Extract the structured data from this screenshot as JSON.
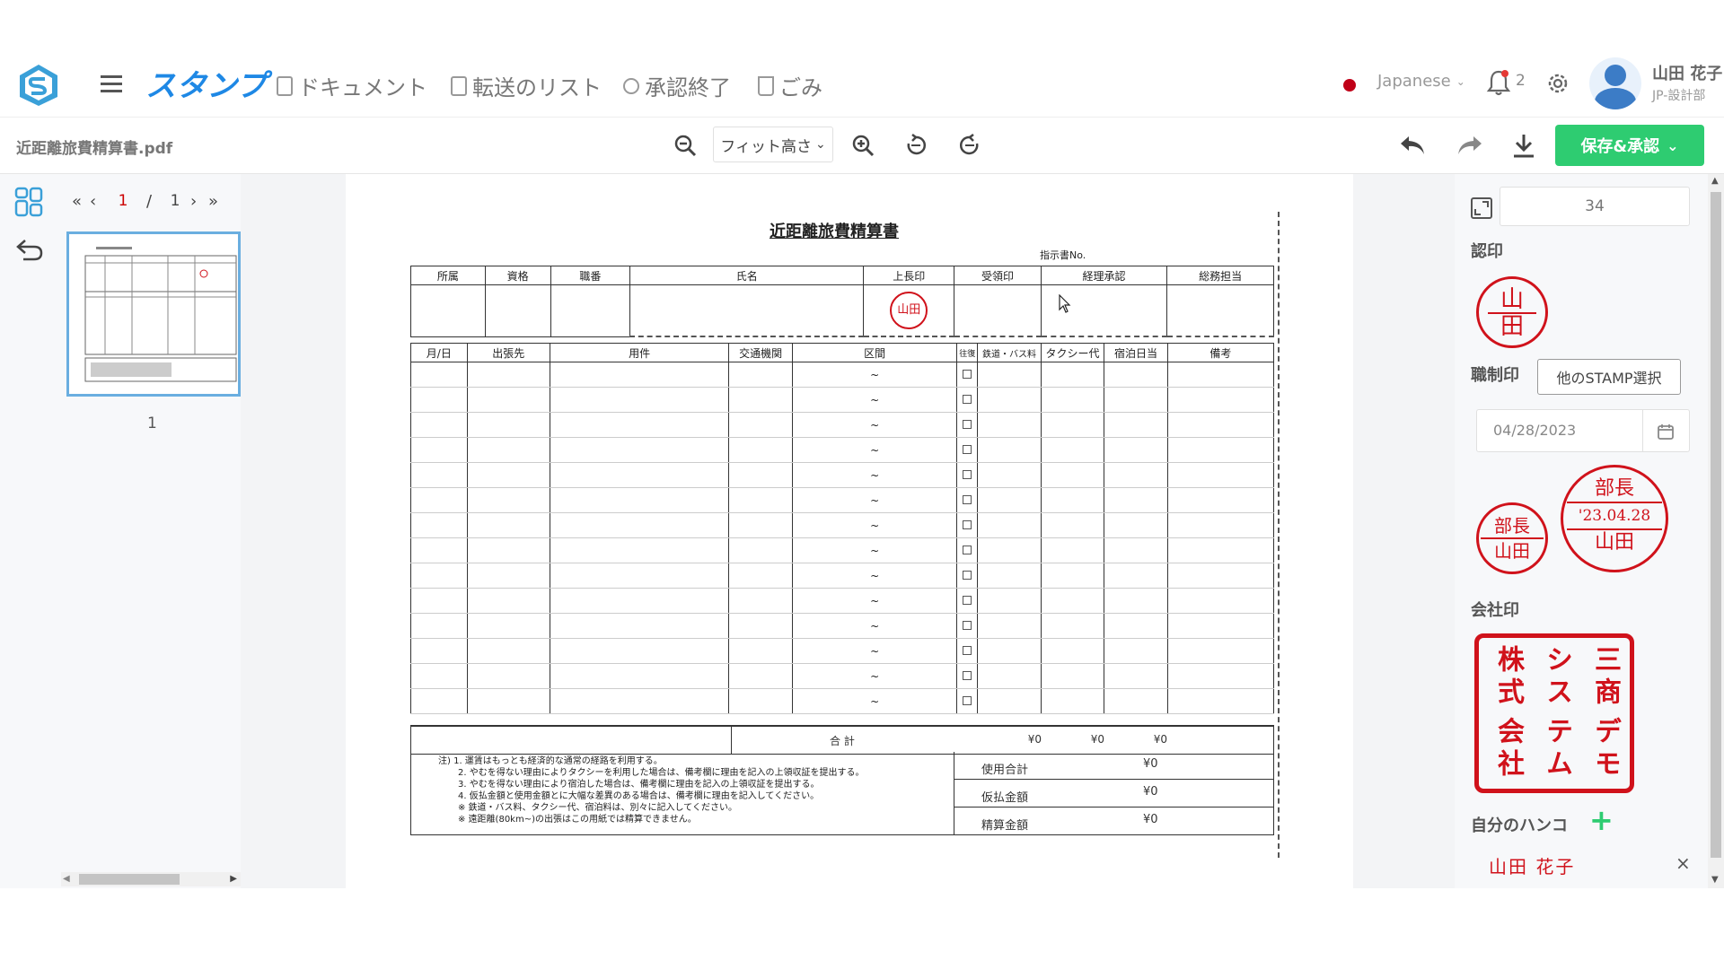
{
  "app": {
    "name": "スタンプ",
    "nav": [
      "ドキュメント",
      "転送のリスト",
      "承認終了",
      "ごみ"
    ],
    "language": "Japanese",
    "notification_count": "2",
    "user": {
      "name": "山田 花子",
      "dept": "JP-設計部"
    }
  },
  "toolbar": {
    "file_name": "近距離旅費精算書.pdf",
    "zoom_mode": "フィット高さ",
    "save_label": "保存&承認"
  },
  "pager": {
    "current": "1",
    "separator": "/",
    "total": "1"
  },
  "thumbnail": {
    "page_label": "1"
  },
  "right": {
    "size_value": "34",
    "ninin_label": "認印",
    "ninin_stamp": [
      "山",
      "田"
    ],
    "shokusei_label": "職制印",
    "other_stamp_button": "他のSTAMP選択",
    "date_value": "04/28/2023",
    "small_stamp": {
      "top": "部長",
      "bottom": "山田"
    },
    "date_stamp": {
      "top": "部長",
      "middle": "'23.04.28",
      "bottom": "山田"
    },
    "company_label": "会社印",
    "company_stamp_cols": [
      "三商",
      "デモ",
      "シス",
      "テム",
      "株式",
      "会社"
    ],
    "my_hanko_label": "自分のハンコ",
    "my_hanko_value": "山田 花子"
  },
  "document": {
    "title": "近距離旅費精算書",
    "memo_no": "指示書No.",
    "header_cols": [
      "所属",
      "資格",
      "職番",
      "氏名",
      "上長印",
      "受領印",
      "経理承認",
      "総務担当"
    ],
    "seal_char": "山田",
    "detail_cols": [
      "月/日",
      "出張先",
      "用件",
      "交通機関",
      "区間",
      "往復",
      "鉄道・バス料",
      "タクシー代",
      "宿泊日当",
      "備考"
    ],
    "tilde": "~",
    "row_count": 14,
    "total_label": "合 計",
    "total_values": [
      "¥0",
      "¥0",
      "¥0"
    ],
    "notes": [
      "注) 1. 運賃はもっとも経済的な通常の経路を利用する。",
      "2. やむを得ない理由によりタクシーを利用した場合は、備考欄に理由を記入の上領収証を提出する。",
      "3. やむを得ない理由により宿泊した場合は、備考欄に理由を記入の上領収証を提出する。",
      "4. 仮払金額と使用金額とに大幅な差異のある場合は、備考欄に理由を記入してください。",
      "※ 鉄道・バス料、タクシー代、宿泊料は、別々に記入してください。",
      "※ 遠距離(80km~)の出張はこの用紙では精算できません。"
    ],
    "summary": [
      {
        "label": "使用合計",
        "value": "¥0"
      },
      {
        "label": "仮払金額",
        "value": "¥0"
      },
      {
        "label": "精算金額",
        "value": "¥0"
      }
    ]
  }
}
